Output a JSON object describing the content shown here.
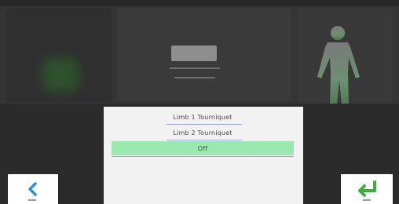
{
  "dialog": {
    "items": [
      {
        "label": "Limb 1 Tourniquet",
        "selected": false
      },
      {
        "label": "Limb 2 Tourniquet",
        "selected": false
      },
      {
        "label": "Off",
        "selected": true
      }
    ],
    "highlight_color": "#9be7b0"
  },
  "controls": {
    "back_icon": "chevron-left-icon",
    "confirm_icon": "enter-arrow-icon",
    "back_color": "#2f8fd8",
    "confirm_color": "#3fae3f"
  },
  "background": {
    "body_figure_icon": "human-body-icon",
    "body_figure_color": "#6e8f72"
  }
}
